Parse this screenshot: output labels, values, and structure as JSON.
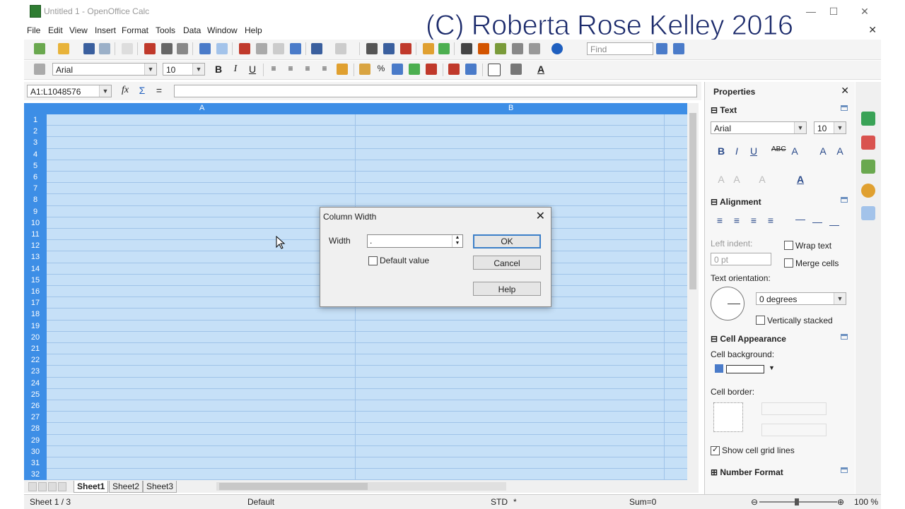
{
  "window": {
    "title": "Untitled 1 - OpenOffice Calc",
    "watermark": "(C) Roberta Rose Kelley 2016"
  },
  "menu": [
    "File",
    "Edit",
    "View",
    "Insert",
    "Format",
    "Tools",
    "Data",
    "Window",
    "Help"
  ],
  "toolbar": {
    "find_placeholder": "Find",
    "font_name": "Arial",
    "font_size": "10"
  },
  "formula_bar": {
    "name_box": "A1:L1048576",
    "content": ""
  },
  "grid": {
    "columns": [
      "A",
      "B"
    ],
    "rows": [
      "1",
      "2",
      "3",
      "4",
      "5",
      "6",
      "7",
      "8",
      "9",
      "10",
      "11",
      "12",
      "13",
      "14",
      "15",
      "16",
      "17",
      "18",
      "19",
      "20",
      "21",
      "22",
      "23",
      "24",
      "25",
      "26",
      "27",
      "28",
      "29",
      "30",
      "31",
      "32"
    ]
  },
  "sheet_tabs": [
    "Sheet1",
    "Sheet2",
    "Sheet3"
  ],
  "status": {
    "sheet": "Sheet 1 / 3",
    "page_style": "Default",
    "mode": "STD",
    "modified": "*",
    "sum": "Sum=0",
    "zoom": "100 %"
  },
  "sidebar": {
    "title": "Properties",
    "text_section": {
      "title": "Text",
      "font": "Arial",
      "size": "10"
    },
    "alignment": {
      "title": "Alignment",
      "left_indent_label": "Left indent:",
      "left_indent_value": "0 pt",
      "wrap_text": "Wrap text",
      "merge_cells": "Merge cells",
      "orientation_label": "Text orientation:",
      "orientation_value": "0 degrees",
      "vertically_stacked": "Vertically stacked"
    },
    "cell_appearance": {
      "title": "Cell Appearance",
      "background_label": "Cell background:",
      "border_label": "Cell border:",
      "show_grid": "Show cell grid lines"
    },
    "number_format": {
      "title": "Number Format"
    }
  },
  "dialog": {
    "title": "Column Width",
    "width_label": "Width",
    "width_value": ".",
    "default_value_label": "Default value",
    "ok": "OK",
    "cancel": "Cancel",
    "help": "Help"
  }
}
